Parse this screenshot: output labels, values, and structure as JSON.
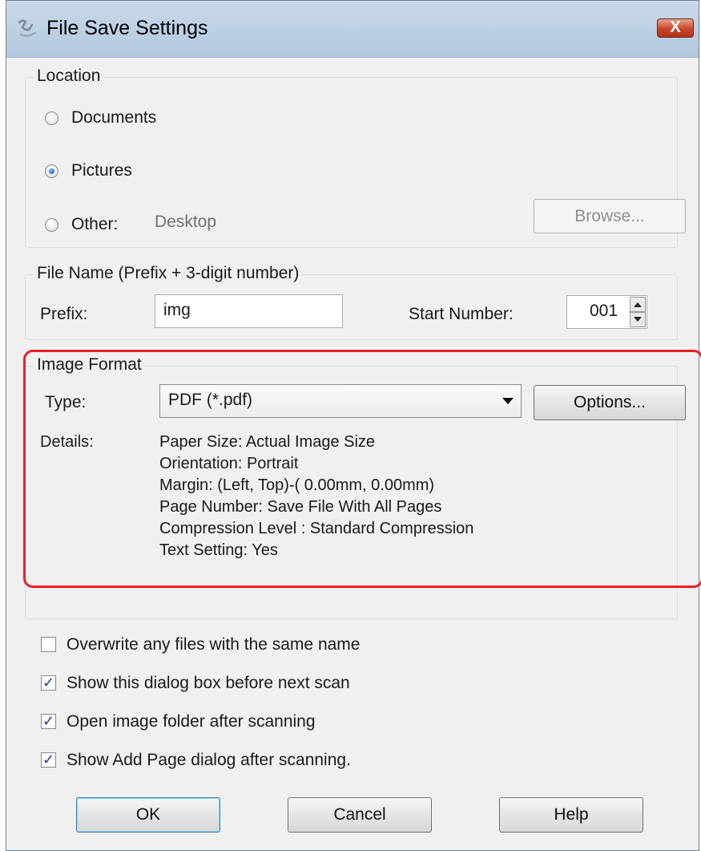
{
  "window": {
    "title": "File Save Settings",
    "close_glyph": "X"
  },
  "location": {
    "group_label": "Location",
    "options": [
      {
        "label": "Documents",
        "selected": false
      },
      {
        "label": "Pictures",
        "selected": true
      },
      {
        "label": "Other:",
        "selected": false
      }
    ],
    "other_value": "Desktop",
    "browse_label": "Browse..."
  },
  "file_name": {
    "group_label": "File Name (Prefix + 3-digit number)",
    "prefix_label": "Prefix:",
    "prefix_value": "img",
    "start_number_label": "Start Number:",
    "start_number_value": "001"
  },
  "image_format": {
    "group_label": "Image Format",
    "type_label": "Type:",
    "type_value": "PDF (*.pdf)",
    "options_label": "Options...",
    "details_label": "Details:",
    "details": [
      "Paper Size: Actual Image Size",
      "Orientation: Portrait",
      "Margin: (Left, Top)-( 0.00mm, 0.00mm)",
      "Page Number: Save File With All Pages",
      "Compression Level : Standard Compression",
      "Text Setting: Yes"
    ],
    "highlight_color": "#e8202a"
  },
  "checkboxes": [
    {
      "label": "Overwrite any files with the same name",
      "checked": false
    },
    {
      "label": "Show this dialog box before next scan",
      "checked": true
    },
    {
      "label": "Open image folder after scanning",
      "checked": true
    },
    {
      "label": "Show Add Page dialog after scanning.",
      "checked": true
    }
  ],
  "buttons": {
    "ok": "OK",
    "cancel": "Cancel",
    "help": "Help"
  },
  "icons": {
    "title": "scanner-icon",
    "close": "close-icon",
    "dropdown": "chevron-down-icon",
    "spinner": "spinner-arrows-icon"
  }
}
